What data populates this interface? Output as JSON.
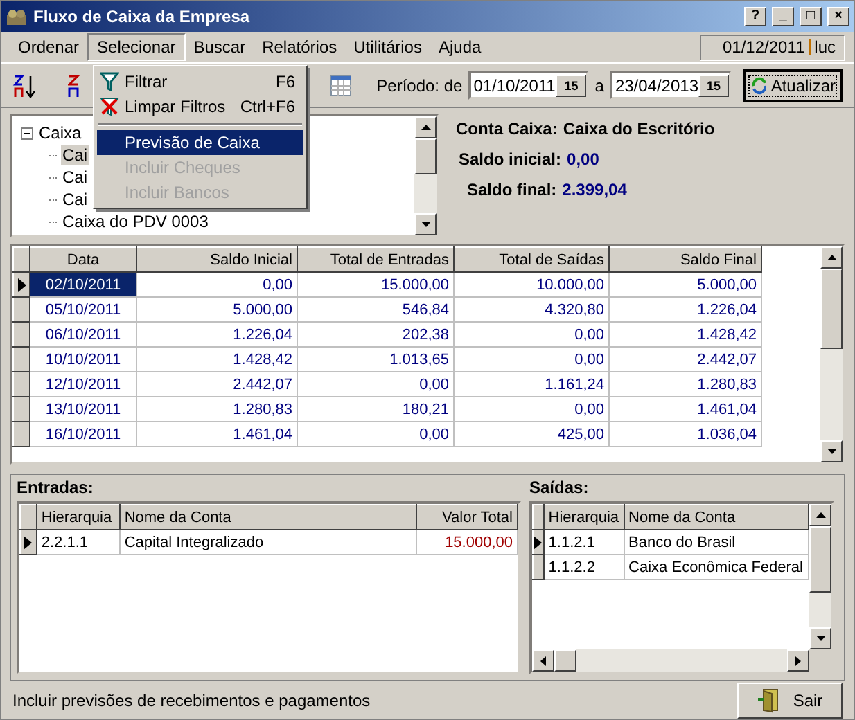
{
  "window": {
    "title": "Fluxo de Caixa da Empresa",
    "controls": [
      "?",
      "_",
      "□",
      "×"
    ]
  },
  "menu_bar": {
    "items": [
      {
        "label": "Ordenar",
        "selected": false
      },
      {
        "label": "Selecionar",
        "selected": true
      },
      {
        "label": "Buscar",
        "selected": false
      },
      {
        "label": "Relatórios",
        "selected": false
      },
      {
        "label": "Utilitários",
        "selected": false
      },
      {
        "label": "Ajuda",
        "selected": false
      }
    ],
    "session_date": "01/12/2011",
    "session_user": "luc"
  },
  "dropdown": {
    "items": [
      {
        "kind": "item",
        "label": "Filtrar",
        "shortcut": "F6",
        "selected": false,
        "disabled": false
      },
      {
        "kind": "item",
        "label": "Limpar Filtros",
        "shortcut": "Ctrl+F6",
        "selected": false,
        "disabled": false
      },
      {
        "kind": "separator"
      },
      {
        "kind": "item",
        "label": "Previsão de Caixa",
        "selected": true,
        "disabled": false
      },
      {
        "kind": "item",
        "label": "Incluir Cheques",
        "selected": false,
        "disabled": true
      },
      {
        "kind": "item",
        "label": "Incluir Bancos",
        "selected": false,
        "disabled": true
      }
    ]
  },
  "toolbar": {
    "period_label": "Período: de",
    "date_from": "01/10/2011",
    "date_separator": "a",
    "date_to": "23/04/2013",
    "calendar_button_from": "15",
    "calendar_button_to": "15",
    "refresh_button": "Atualizar"
  },
  "tree": {
    "label": "Caixa",
    "expanded": true,
    "children": [
      {
        "label": "Cai",
        "selected": true
      },
      {
        "label": "Cai",
        "selected": false
      },
      {
        "label": "Cai",
        "selected": false
      },
      {
        "label": "Caixa do PDV 0003",
        "selected": false
      }
    ]
  },
  "account_info": {
    "account_label": "Conta Caixa:",
    "account_name": "Caixa do Escritório",
    "initial_label": "Saldo inicial:",
    "initial_value": "0,00",
    "final_label": "Saldo final:",
    "final_value": "2.399,04"
  },
  "cash_grid": {
    "columns": [
      "Data",
      "Saldo Inicial",
      "Total de Entradas",
      "Total de Saídas",
      "Saldo Final"
    ],
    "rows": [
      {
        "cells": [
          "02/10/2011",
          "0,00",
          "15.000,00",
          "10.000,00",
          "5.000,00"
        ],
        "selected": true
      },
      {
        "cells": [
          "05/10/2011",
          "5.000,00",
          "546,84",
          "4.320,80",
          "1.226,04"
        ],
        "selected": false
      },
      {
        "cells": [
          "06/10/2011",
          "1.226,04",
          "202,38",
          "0,00",
          "1.428,42"
        ],
        "selected": false
      },
      {
        "cells": [
          "10/10/2011",
          "1.428,42",
          "1.013,65",
          "0,00",
          "2.442,07"
        ],
        "selected": false
      },
      {
        "cells": [
          "12/10/2011",
          "2.442,07",
          "0,00",
          "1.161,24",
          "1.280,83"
        ],
        "selected": false
      },
      {
        "cells": [
          "13/10/2011",
          "1.280,83",
          "180,21",
          "0,00",
          "1.461,04"
        ],
        "selected": false
      },
      {
        "cells": [
          "16/10/2011",
          "1.461,04",
          "0,00",
          "425,00",
          "1.036,04"
        ],
        "selected": false
      }
    ]
  },
  "entradas": {
    "title": "Entradas:",
    "columns": [
      "Hierarquia",
      "Nome da Conta",
      "Valor Total"
    ],
    "rows": [
      {
        "cells": [
          "2.2.1.1",
          "Capital Integralizado",
          "15.000,00"
        ],
        "selected": true
      }
    ]
  },
  "saidas": {
    "title": "Saídas:",
    "columns": [
      "Hierarquia",
      "Nome da Conta"
    ],
    "rows": [
      {
        "cells": [
          "1.1.2.1",
          "Banco do Brasil"
        ],
        "selected": true
      },
      {
        "cells": [
          "1.1.2.2",
          "Caixa Econômica Federal"
        ],
        "selected": false
      }
    ]
  },
  "status_bar": {
    "message": "Incluir previsões de recebimentos e pagamentos",
    "exit_button": "Sair"
  }
}
